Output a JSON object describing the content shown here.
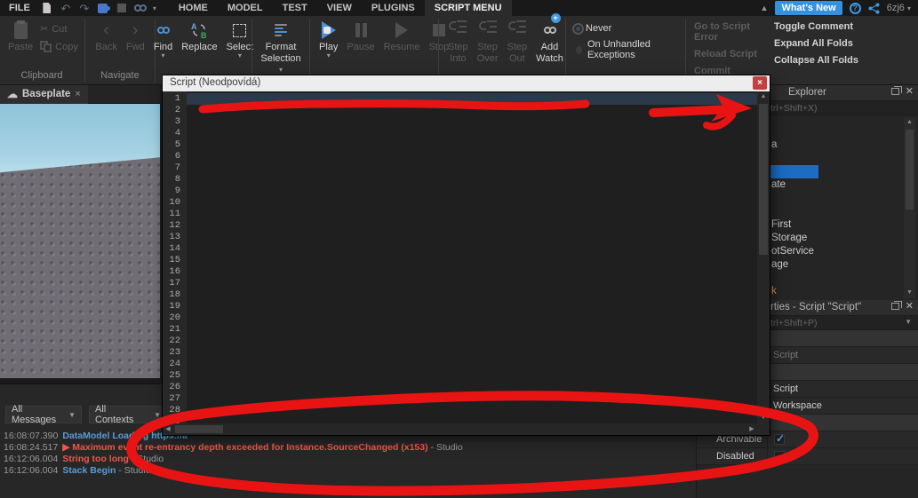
{
  "colors": {
    "accent_blue": "#1b6cc2",
    "whats_new_bg": "#3391de",
    "annotation_red": "#e81414",
    "error_red": "#f0564a",
    "info_blue": "#5b9bd5",
    "link_blue": "#4da3e0",
    "check_blue": "#45a2e8"
  },
  "menu": {
    "file": "FILE",
    "tabs": [
      "HOME",
      "MODEL",
      "TEST",
      "VIEW",
      "PLUGINS",
      "SCRIPT MENU"
    ],
    "active_tab": "SCRIPT MENU",
    "whats_new": "What's New",
    "version": "6zj6"
  },
  "ribbon": {
    "clipboard": {
      "label": "Clipboard",
      "paste": "Paste",
      "cut": "Cut",
      "copy": "Copy"
    },
    "navigate": {
      "label": "Navigate",
      "back": "Back",
      "fwd": "Fwd"
    },
    "find": {
      "find": "Find",
      "replace": "Replace",
      "select": "Select"
    },
    "format": {
      "line1": "Format",
      "line2": "Selection"
    },
    "playback": {
      "play": "Play",
      "pause": "Pause",
      "resume": "Resume",
      "stop": "Stop"
    },
    "debug": {
      "step_into": {
        "l1": "Step",
        "l2": "Into"
      },
      "step_over": {
        "l1": "Step",
        "l2": "Over"
      },
      "step_out": {
        "l1": "Step",
        "l2": "Out"
      },
      "add_watch": {
        "l1": "Add",
        "l2": "Watch"
      }
    },
    "exceptions": [
      {
        "label": "Never",
        "selected": true
      },
      {
        "label": "On Unhandled Exceptions",
        "selected": false
      }
    ],
    "script_actions_disabled": [
      "Go to Script Error",
      "Reload Script",
      "Commit"
    ],
    "script_actions_enabled": [
      "Toggle Comment",
      "Expand All Folds",
      "Collapse All Folds"
    ]
  },
  "viewport": {
    "tab": "Baseplate",
    "close": "×"
  },
  "script_window": {
    "tab_title": "Script (Neodpovídá)",
    "close": "×",
    "line_count": 29
  },
  "explorer": {
    "title": "Explorer",
    "filter_fragment": "trl+Shift+X)",
    "items": [
      {
        "frag": ""
      },
      {
        "frag": "a"
      },
      {
        "frag": ""
      },
      {
        "frag": "",
        "selected": true
      },
      {
        "frag": "ate"
      },
      {
        "frag": ""
      },
      {
        "frag": ""
      },
      {
        "frag": "First"
      },
      {
        "frag": "Storage"
      },
      {
        "frag": "otService"
      },
      {
        "frag": "age"
      },
      {
        "frag": ""
      },
      {
        "frag": "k",
        "accent": true
      }
    ]
  },
  "properties": {
    "title_fragment": "rties - Script \"Script\"",
    "filter_fragment": "trl+Shift+P)",
    "rows": [
      {
        "header": true
      },
      {
        "value": "Script",
        "dim": true
      },
      {
        "header": true
      },
      {
        "value": "Script"
      },
      {
        "value": "Workspace"
      },
      {
        "header": true
      },
      {
        "name": "Archivable",
        "checkbox": true,
        "checked": true
      },
      {
        "name": "Disabled",
        "checkbox": true,
        "checked": false
      }
    ]
  },
  "output": {
    "filters": [
      "All Messages",
      "All Contexts"
    ],
    "messages": [
      {
        "time": "16:08:07.390",
        "parts": [
          {
            "t": "DataModel Loading ",
            "s": "info"
          },
          {
            "t": "https://a",
            "s": "link"
          }
        ]
      },
      {
        "time": "16:08:24.517",
        "parts": [
          {
            "t": "▶ Maximum event re-entrancy depth exceeded for Instance.SourceChanged (x153)",
            "s": "error"
          },
          {
            "t": " - Studio",
            "s": "dim"
          }
        ]
      },
      {
        "time": "16:12:06.004",
        "parts": [
          {
            "t": "String too long",
            "s": "error"
          },
          {
            "t": " - Studio",
            "s": "dim"
          }
        ]
      },
      {
        "time": "16:12:06.004",
        "parts": [
          {
            "t": "Stack Begin",
            "s": "info"
          },
          {
            "t": " - Studio",
            "s": "dim"
          }
        ]
      }
    ]
  }
}
